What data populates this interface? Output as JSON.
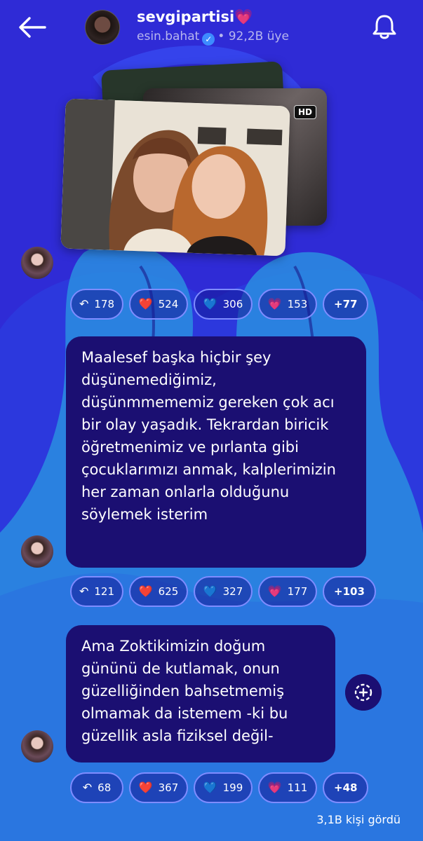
{
  "header": {
    "channel_name": "sevgipartisi",
    "channel_emoji": "💗",
    "owner": "esin.bahat",
    "separator": "•",
    "members": "92,2B üye"
  },
  "colors": {
    "background": "#2f2bd6",
    "bubble": "#1b0f72",
    "chip_border": "#7f8cff",
    "accent_blob": "#2a8ee0"
  },
  "media": {
    "hd_badge": "HD"
  },
  "posts": [
    {
      "text": "",
      "reactions": {
        "replies": "178",
        "red_heart": "524",
        "blue_heart": "306",
        "pink_heart": "153",
        "more": "+77"
      }
    },
    {
      "text": "Maalesef başka hiçbir şey düşünemediğimiz, düşünmmememiz gereken çok acı bir olay yaşadık. Tekrardan biricik öğretmenimiz ve pırlanta gibi çocuklarımızı anmak, kalplerimizin her zaman onlarla olduğunu söylemek isterim",
      "reactions": {
        "replies": "121",
        "red_heart": "625",
        "blue_heart": "327",
        "pink_heart": "177",
        "more": "+103"
      }
    },
    {
      "text": "Ama Zoktikimizin doğum gününü de kutlamak, onun güzelliğinden bahsetmemiş olmamak da istemem -ki bu güzellik asla fiziksel değil-",
      "reactions": {
        "replies": "68",
        "red_heart": "367",
        "blue_heart": "199",
        "pink_heart": "111",
        "more": "+48"
      }
    }
  ],
  "emoji": {
    "red_heart": "❤️",
    "blue_heart": "💙",
    "pink_heart": "💗"
  },
  "footer": {
    "views": "3,1B kişi gördü"
  }
}
